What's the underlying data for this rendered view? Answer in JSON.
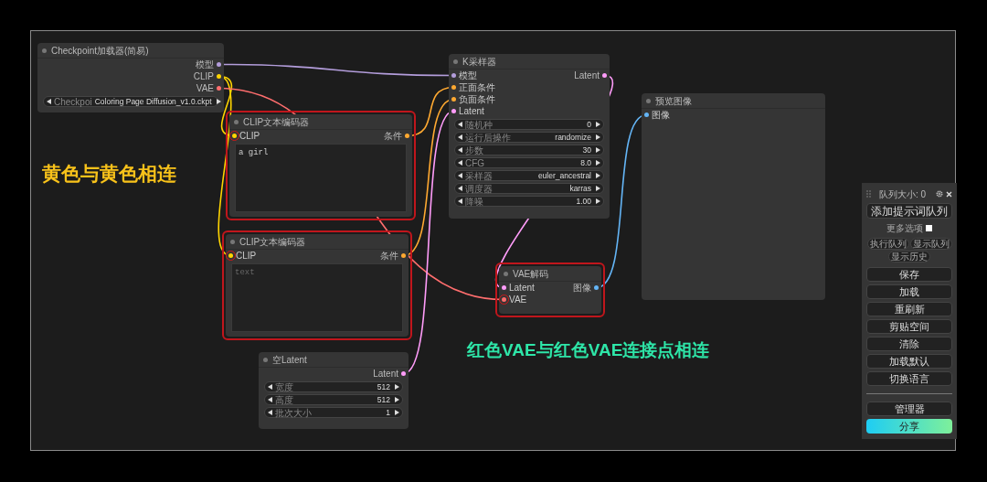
{
  "nodes": [
    {
      "title": "Checkpoint加载器(简易)",
      "highlighted": false,
      "outputs": [
        {
          "label": "模型",
          "color": "#b39ddb"
        },
        {
          "label": "CLIP",
          "color": "#ffd500"
        },
        {
          "label": "VAE",
          "color": "#ff6e6e"
        }
      ],
      "widgets": [
        {
          "label": "Checkpoi",
          "value": "Coloring Page Diffusion_v1.0.ckpt"
        }
      ]
    },
    {
      "title": "CLIP文本编码器",
      "highlighted": true,
      "inputs": [
        {
          "label": "CLIP",
          "color": "#ffd500",
          "highlighted": true
        }
      ],
      "outputs": [
        {
          "label": "条件",
          "color": "#ffa931"
        }
      ],
      "text_box": {
        "value": "a girl"
      }
    },
    {
      "title": "CLIP文本编码器",
      "highlighted": true,
      "inputs": [
        {
          "label": "CLIP",
          "color": "#ffd500",
          "highlighted": true
        }
      ],
      "outputs": [
        {
          "label": "条件",
          "color": "#ffa931"
        }
      ],
      "text_box": {
        "placeholder": "text"
      }
    },
    {
      "title": "K采样器",
      "highlighted": false,
      "inputs": [
        {
          "label": "模型",
          "color": "#b39ddb",
          "highlighted": false
        },
        {
          "label": "正面条件",
          "color": "#ffa931",
          "highlighted": false
        },
        {
          "label": "负面条件",
          "color": "#ffa931",
          "highlighted": false
        },
        {
          "label": "Latent",
          "color": "#ff9cf9",
          "highlighted": false
        }
      ],
      "outputs": [
        {
          "label": "Latent",
          "color": "#ff9cf9"
        }
      ],
      "widgets": [
        {
          "label": "随机种",
          "value": "0"
        },
        {
          "label": "运行后操作",
          "value": "randomize"
        },
        {
          "label": "步数",
          "value": "30"
        },
        {
          "label": "CFG",
          "value": "8.0"
        },
        {
          "label": "采样器",
          "value": "euler_ancestral"
        },
        {
          "label": "调度器",
          "value": "karras"
        },
        {
          "label": "降噪",
          "value": "1.00"
        }
      ]
    },
    {
      "title": "预览图像",
      "highlighted": false,
      "inputs": [
        {
          "label": "图像",
          "color": "#64b5f6",
          "highlighted": false
        }
      ]
    },
    {
      "title": "VAE解码",
      "highlighted": true,
      "inputs": [
        {
          "label": "Latent",
          "color": "#ff9cf9",
          "highlighted": false
        },
        {
          "label": "VAE",
          "color": "#ff6e6e",
          "highlighted": true
        }
      ],
      "outputs": [
        {
          "label": "图像",
          "color": "#64b5f6"
        }
      ]
    },
    {
      "title": "空Latent",
      "highlighted": false,
      "outputs": [
        {
          "label": "Latent",
          "color": "#ff9cf9"
        }
      ],
      "widgets": [
        {
          "label": "宽度",
          "value": "512"
        },
        {
          "label": "高度",
          "value": "512"
        },
        {
          "label": "批次大小",
          "value": "1"
        }
      ]
    }
  ],
  "annotations": [
    "黄色与黄色相连",
    "红色VAE与红色VAE连接点相连"
  ],
  "queue_panel": {
    "title": "队列大小: 0",
    "queue_button": "添加提示词队列",
    "more_options": {
      "label": "更多选项",
      "checked": false
    },
    "small_buttons": [
      "执行队列",
      "显示队列",
      "显示历史"
    ],
    "buttons": [
      "保存",
      "加载",
      "重刷新",
      "剪贴空间",
      "清除",
      "加载默认",
      "切换语言"
    ],
    "manager_button": "管理器",
    "share_button": "分享"
  }
}
